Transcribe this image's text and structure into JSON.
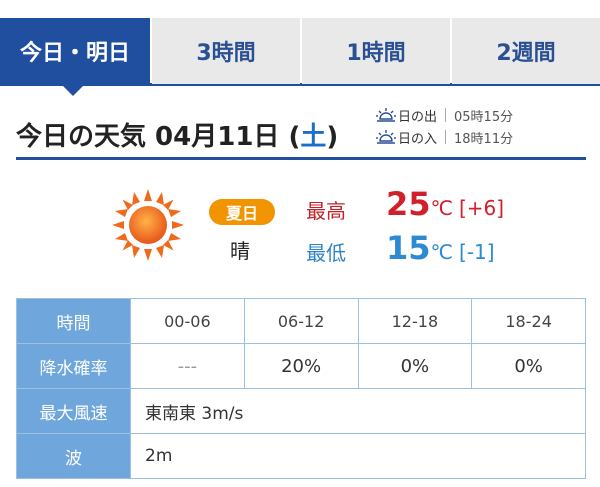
{
  "tabs": [
    {
      "label": "今日・明日",
      "active": true
    },
    {
      "label": "3時間",
      "active": false
    },
    {
      "label": "1時間",
      "active": false
    },
    {
      "label": "2週間",
      "active": false
    }
  ],
  "header": {
    "title_prefix": "今日の天気 04月11日 (",
    "weekday": "土",
    "title_suffix": ")",
    "sunrise_label": "日の出",
    "sunrise_time": "05時15分",
    "sunset_label": "日の入",
    "sunset_time": "18時11分"
  },
  "summary": {
    "weather_icon": "sunny-icon",
    "badge": "夏日",
    "condition": "晴",
    "high_label": "最高",
    "high_value": "25",
    "high_unit": "℃",
    "high_diff": "[+6]",
    "low_label": "最低",
    "low_value": "15",
    "low_unit": "℃",
    "low_diff": "[-1]"
  },
  "forecast_table": {
    "time_header": "時間",
    "periods": [
      "00-06",
      "06-12",
      "12-18",
      "18-24"
    ],
    "precip_header": "降水確率",
    "precip": [
      "---",
      "20%",
      "0%",
      "0%"
    ],
    "wind_header": "最大風速",
    "wind": "東南東 3m/s",
    "wave_header": "波",
    "wave": "2m"
  },
  "colors": {
    "brand_blue": "#1f4f9e",
    "table_header_blue": "#6fa6db",
    "high_red": "#d0202b",
    "low_blue": "#2d8ad0",
    "badge_orange": "#f29300"
  }
}
